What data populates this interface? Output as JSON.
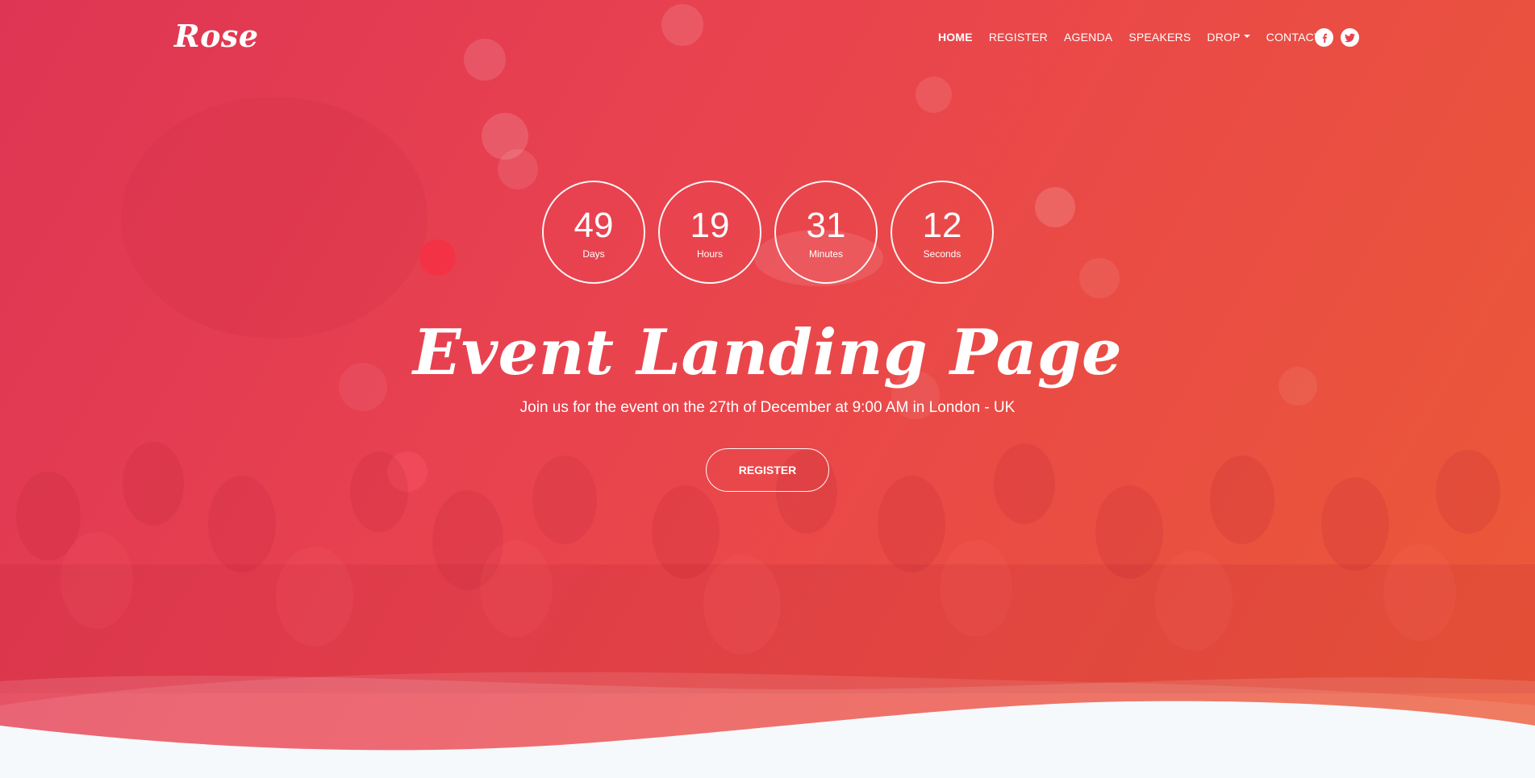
{
  "brand": {
    "logo": "Rose"
  },
  "nav": {
    "items": [
      {
        "label": "HOME",
        "active": true
      },
      {
        "label": "REGISTER"
      },
      {
        "label": "AGENDA"
      },
      {
        "label": "SPEAKERS"
      },
      {
        "label": "DROP",
        "dropdown": true
      },
      {
        "label": "CONTACT"
      }
    ],
    "social": [
      {
        "icon": "facebook-icon"
      },
      {
        "icon": "twitter-icon"
      }
    ]
  },
  "countdown": [
    {
      "value": "49",
      "unit": "Days"
    },
    {
      "value": "19",
      "unit": "Hours"
    },
    {
      "value": "31",
      "unit": "Minutes"
    },
    {
      "value": "12",
      "unit": "Seconds"
    }
  ],
  "hero": {
    "title": "Event Landing Page",
    "subtitle": "Join us for the event on the 27th of December at 9:00 AM in London - UK",
    "cta": "REGISTER"
  },
  "colors": {
    "accent_start": "#de3554",
    "accent_end": "#ec5a37",
    "page_bg": "#f5f9fb"
  }
}
